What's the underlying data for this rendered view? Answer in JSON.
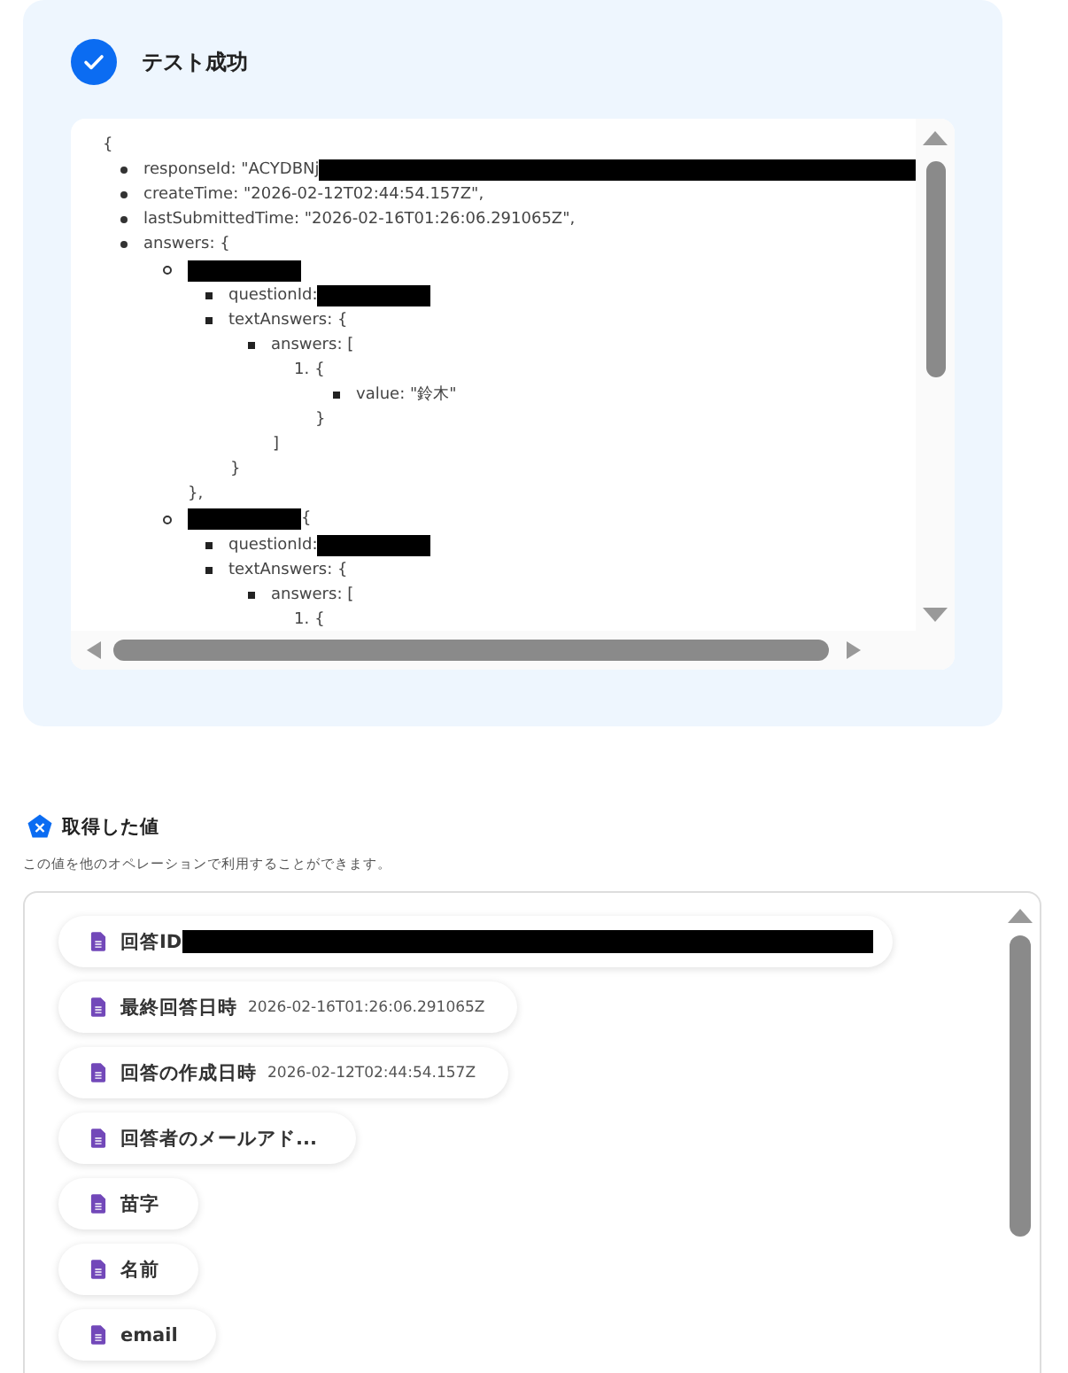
{
  "result": {
    "title": "テスト成功",
    "code": {
      "open": "{",
      "items": [
        {
          "kind": "disc",
          "text": "responseId: \"ACYDBNj",
          "redacted_after": true
        },
        {
          "kind": "disc",
          "text": "createTime: \"2026-02-12T02:44:54.157Z\","
        },
        {
          "kind": "disc",
          "text": "lastSubmittedTime: \"2026-02-16T01:26:06.291065Z\","
        },
        {
          "kind": "disc",
          "text": "answers: {",
          "children": [
            {
              "kind": "circle",
              "redacted_before": true,
              "close": "},",
              "children": [
                {
                  "kind": "square",
                  "text": "questionId:",
                  "redacted_after": true
                },
                {
                  "kind": "square",
                  "text": "textAnswers: {",
                  "close": "}",
                  "children": [
                    {
                      "kind": "square",
                      "text": "answers: [",
                      "close": "]",
                      "children": [
                        {
                          "kind": "number",
                          "number": "1.",
                          "text": "{",
                          "close": "}",
                          "children": [
                            {
                              "kind": "square",
                              "text": "value: \"鈴木\""
                            }
                          ]
                        }
                      ]
                    }
                  ]
                }
              ]
            },
            {
              "kind": "circle",
              "text": "{",
              "redacted_before": true,
              "children": [
                {
                  "kind": "square",
                  "text": "questionId:",
                  "redacted_after": true
                },
                {
                  "kind": "square",
                  "text": "textAnswers: {",
                  "children": [
                    {
                      "kind": "square",
                      "text": "answers: [",
                      "children": [
                        {
                          "kind": "number",
                          "number": "1.",
                          "text": "{"
                        }
                      ]
                    }
                  ]
                }
              ]
            }
          ]
        }
      ]
    }
  },
  "values": {
    "title": "取得した値",
    "description": "この値を他のオペレーションで利用することができます。",
    "items": [
      {
        "label": "回答ID",
        "redacted": true
      },
      {
        "label": "最終回答日時",
        "value": "2026-02-16T01:26:06.291065Z"
      },
      {
        "label": "回答の作成日時",
        "value": "2026-02-12T02:44:54.157Z"
      },
      {
        "label": "回答者のメールアド..."
      },
      {
        "label": "苗字"
      },
      {
        "label": "名前"
      },
      {
        "label": "email"
      }
    ]
  }
}
